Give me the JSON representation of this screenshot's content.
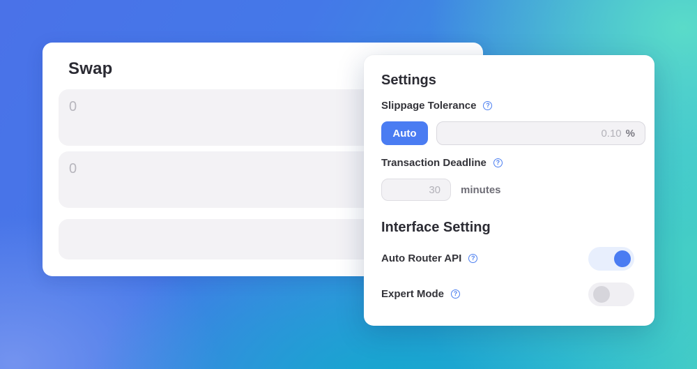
{
  "swap": {
    "title": "Swap",
    "input_value": "0",
    "output_value": "0"
  },
  "settings": {
    "title": "Settings",
    "slippage_label": "Slippage Tolerance",
    "auto_label": "Auto",
    "slippage_value": "0.10",
    "slippage_unit": "%",
    "deadline_label": "Transaction Deadline",
    "deadline_value": "30",
    "deadline_unit": "minutes",
    "interface_title": "Interface Setting",
    "router_label": "Auto Router API",
    "router_enabled": true,
    "expert_label": "Expert Mode",
    "expert_enabled": false,
    "help_glyph": "?"
  },
  "colors": {
    "accent": "#4a7cf2",
    "help_icon": "#4b7ef0",
    "field_bg": "#f3f2f5"
  },
  "icons": {
    "help": "question-circle-icon"
  }
}
